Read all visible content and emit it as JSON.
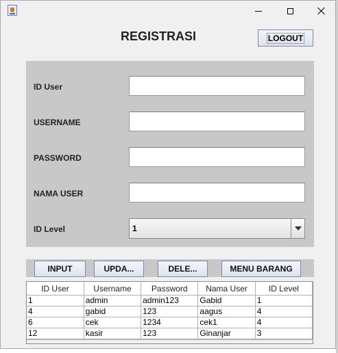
{
  "window": {
    "app_icon": "java-cup-icon",
    "controls": {
      "minimize": "minimize-icon",
      "maximize": "maximize-icon",
      "close": "close-icon"
    }
  },
  "header": {
    "title": "REGISTRASI",
    "logout_label": "LOGOUT"
  },
  "form": {
    "id_user_label": "ID User",
    "id_user_value": "",
    "username_label": "USERNAME",
    "username_value": "",
    "password_label": "PASSWORD",
    "password_value": "",
    "nama_user_label": "NAMA USER",
    "nama_user_value": "",
    "id_level_label": "ID Level",
    "id_level_selected": "1"
  },
  "actions": {
    "input_label": "INPUT",
    "update_label": "UPDA...",
    "delete_label": "DELE...",
    "menu_barang_label": "MENU BARANG"
  },
  "table": {
    "columns": [
      "ID User",
      "Username",
      "Password",
      "Nama User",
      "ID Level"
    ],
    "rows": [
      [
        "1",
        "admin",
        "admin123",
        "Gabid",
        "1"
      ],
      [
        "4",
        "gabid",
        "123",
        "aagus",
        "4"
      ],
      [
        "6",
        "cek",
        "1234",
        "cek1",
        "4"
      ],
      [
        "12",
        "kasir",
        "123",
        "Ginanjar",
        "3"
      ]
    ]
  },
  "colors": {
    "panel": "#c8c8c8",
    "window_bg": "#f0f0f0",
    "button_border": "#7a8aa6"
  }
}
